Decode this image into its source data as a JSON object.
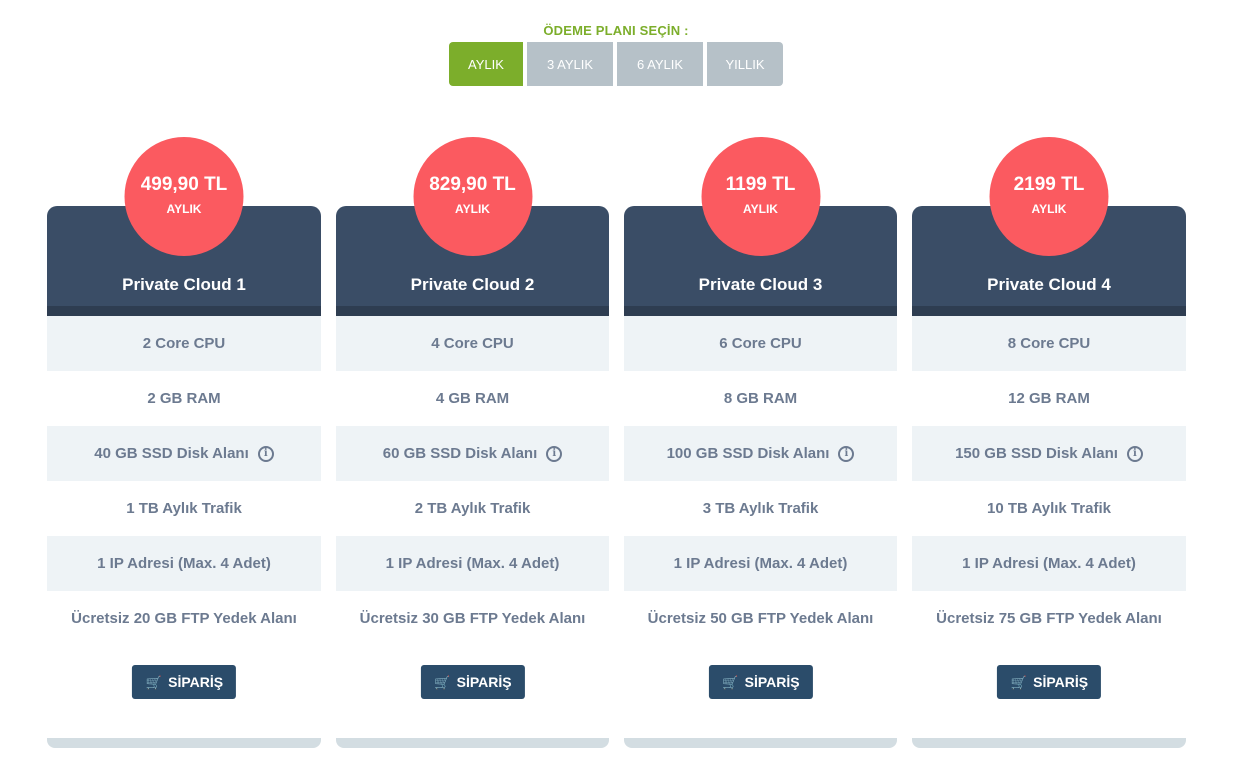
{
  "plan_selector": {
    "title": "ÖDEME PLANI SEÇİN :",
    "tabs": [
      {
        "label": "AYLIK",
        "active": true
      },
      {
        "label": "3 AYLIK",
        "active": false
      },
      {
        "label": "6 AYLIK",
        "active": false
      },
      {
        "label": "YILLIK",
        "active": false
      }
    ]
  },
  "cards": [
    {
      "price": "499,90 TL",
      "period": "AYLIK",
      "title": "Private Cloud 1",
      "features": [
        "2 Core CPU",
        "2 GB RAM",
        "40 GB SSD Disk Alanı",
        "1 TB Aylık Trafik",
        "1 IP Adresi (Max. 4 Adet)",
        "Ücretsiz 20 GB FTP Yedek Alanı"
      ],
      "order_label": "SİPARİŞ"
    },
    {
      "price": "829,90 TL",
      "period": "AYLIK",
      "title": "Private Cloud 2",
      "features": [
        "4 Core CPU",
        "4 GB RAM",
        "60 GB SSD Disk Alanı",
        "2 TB Aylık Trafik",
        "1 IP Adresi (Max. 4 Adet)",
        "Ücretsiz 30 GB FTP Yedek Alanı"
      ],
      "order_label": "SİPARİŞ"
    },
    {
      "price": "1199 TL",
      "period": "AYLIK",
      "title": "Private Cloud 3",
      "features": [
        "6 Core CPU",
        "8 GB RAM",
        "100 GB SSD Disk Alanı",
        "3 TB Aylık Trafik",
        "1 IP Adresi (Max. 4 Adet)",
        "Ücretsiz 50 GB FTP Yedek Alanı"
      ],
      "order_label": "SİPARİŞ"
    },
    {
      "price": "2199 TL",
      "period": "AYLIK",
      "title": "Private Cloud 4",
      "features": [
        "8 Core CPU",
        "12 GB RAM",
        "150 GB SSD Disk Alanı",
        "10 TB Aylık Trafik",
        "1 IP Adresi (Max. 4 Adet)",
        "Ücretsiz 75 GB FTP Yedek Alanı"
      ],
      "order_label": "SİPARİŞ"
    }
  ],
  "icons": {
    "info": "info-icon",
    "cart": "cart-icon"
  },
  "colors": {
    "accent_green": "#7cae2b",
    "price_red": "#fb5a60",
    "header_navy": "#3a4d66",
    "button_blue": "#2b4c6a",
    "tab_grey": "#b6c1c8"
  }
}
